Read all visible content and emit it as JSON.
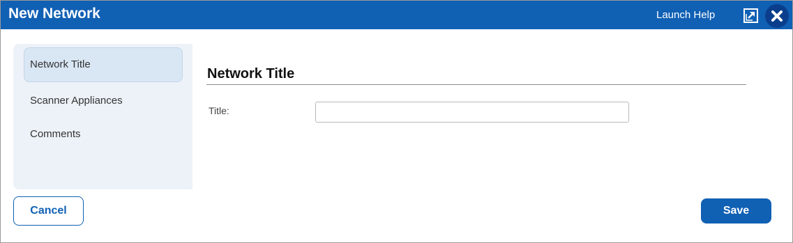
{
  "dialog": {
    "title": "New Network",
    "help_link": "Launch Help",
    "icons": {
      "popout": "popout-icon",
      "close": "close-icon"
    },
    "colors": {
      "brand": "#1060b4",
      "close_bg": "#0a3e8c",
      "sidebar_bg": "#edf2f8",
      "active_item_bg": "#d9e6f4"
    }
  },
  "sidebar": {
    "items": [
      {
        "label": "Network Title",
        "active": true
      },
      {
        "label": "Scanner Appliances",
        "active": false
      },
      {
        "label": "Comments",
        "active": false
      }
    ]
  },
  "main": {
    "section_title": "Network Title",
    "fields": {
      "title": {
        "label": "Title:",
        "value": "",
        "placeholder": ""
      }
    }
  },
  "footer": {
    "cancel_label": "Cancel",
    "save_label": "Save"
  }
}
